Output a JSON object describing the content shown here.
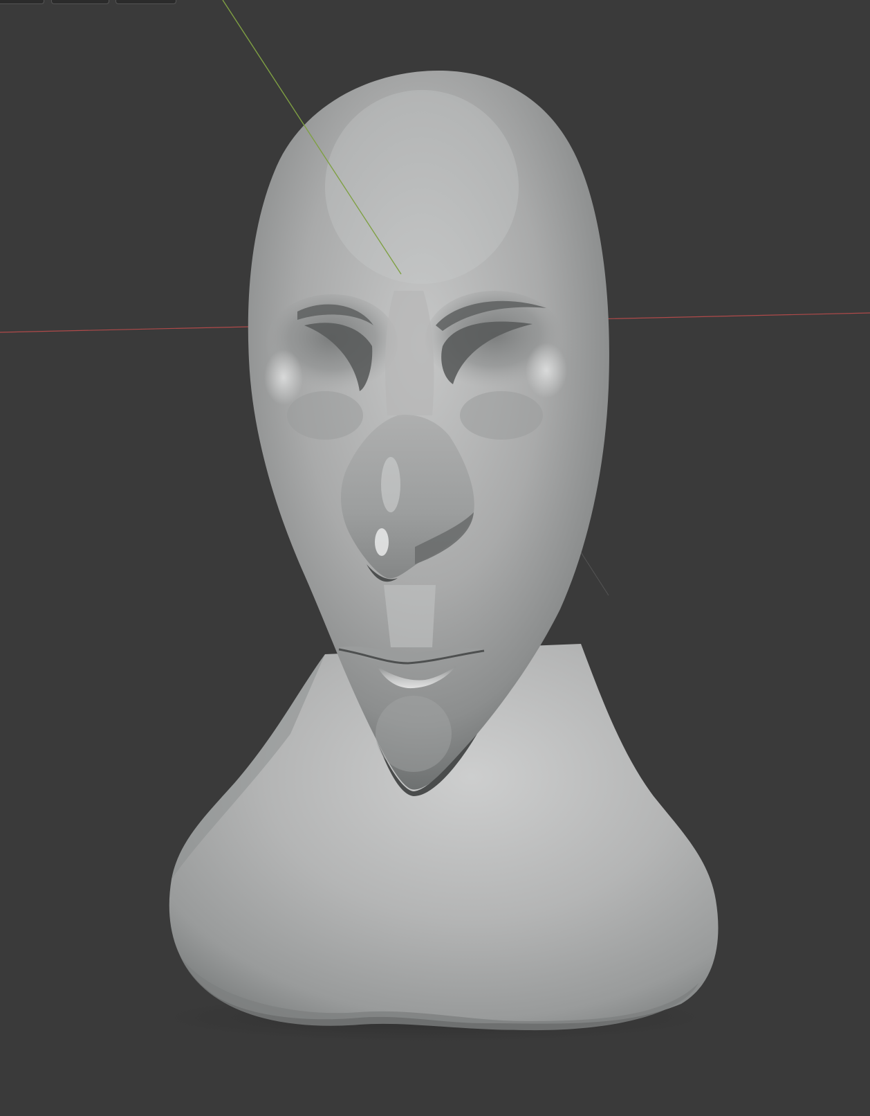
{
  "app": {
    "viewport_background": "#3a3a3a",
    "header_tabs": [
      {
        "id": "tab-1",
        "label": ""
      },
      {
        "id": "tab-2",
        "label": ""
      },
      {
        "id": "tab-3",
        "label": ""
      }
    ]
  },
  "scene": {
    "object": "sculpted-head-bust",
    "shading": "solid-matcap-grey",
    "axis_colors": {
      "x_axis": "#b04a4a",
      "y_axis": "#7fa043"
    }
  }
}
